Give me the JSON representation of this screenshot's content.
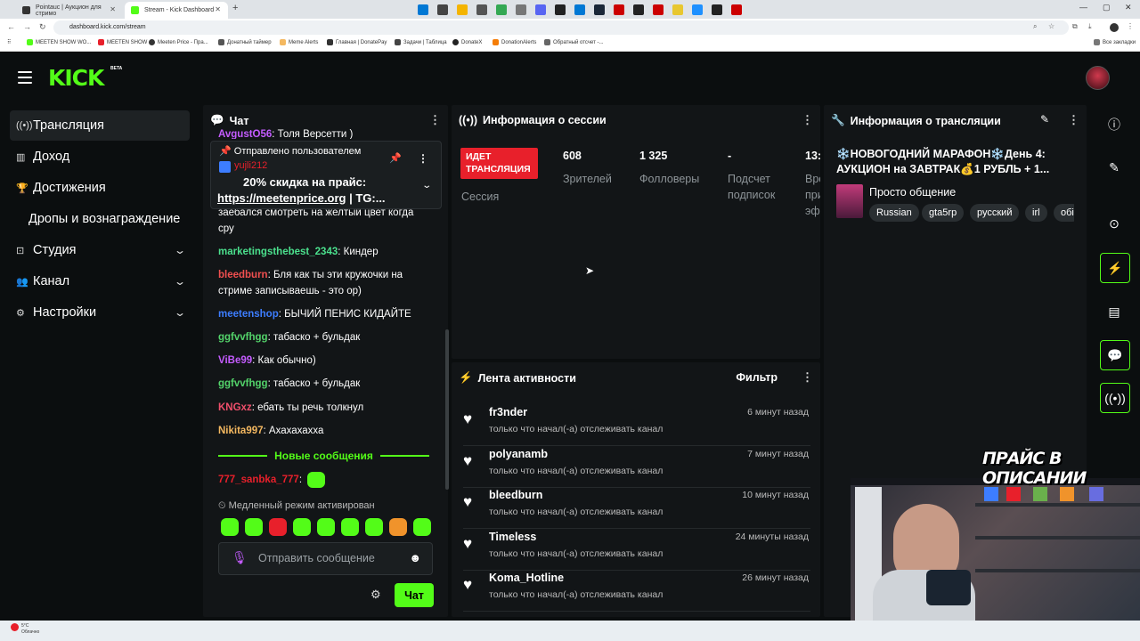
{
  "browser": {
    "tabs": [
      {
        "title": "Pointauc | Аукцион для стримо"
      },
      {
        "title": "Stream - Kick Dashboard"
      }
    ],
    "url": "dashboard.kick.com/stream",
    "bookmarks": [
      "MEETEN SHOW WO...",
      "MEETEN SHOW",
      "Meeten Price - Пра...",
      "Донатный таймер",
      "Meme Alerts",
      "Главная | DonatePay",
      "Задачи | Таблица",
      "DonateX",
      "DonationAlerts",
      "Обратный отсчет -...",
      "Все закладки"
    ]
  },
  "header": {
    "logo": "KICK",
    "beta": "BETA"
  },
  "sidebar": {
    "items": [
      {
        "label": "Трансляция"
      },
      {
        "label": "Доход"
      },
      {
        "label": "Достижения"
      },
      {
        "label": "Дропы и вознаграждение"
      },
      {
        "label": "Студия"
      },
      {
        "label": "Канал"
      },
      {
        "label": "Настройки"
      }
    ]
  },
  "chat": {
    "title": "Чат",
    "top_partial": {
      "user": "AvgustO56",
      "text": ": Толя Версетти )"
    },
    "pinned": {
      "header": "Отправлено пользователем",
      "user": "yujli212",
      "line1": "20% скидка на прайс:",
      "link": "https://meetenprice.org",
      "line2_suffix": " | TG:..."
    },
    "partial_text": "заебался смотреть на желтый цвет когда сру",
    "messages": [
      {
        "user": "marketingsthebest_2343",
        "text": ": Киндер",
        "color": "#4be08d"
      },
      {
        "user": "bleedburn",
        "text": ": Бля как ты эти кружочки на стриме записываешь - это ор)",
        "color": "#ef4f4f"
      },
      {
        "user": "meetenshop",
        "text": ": БЫЧИЙ ПЕНИС КИДАЙТЕ",
        "color": "#3d7dff"
      },
      {
        "user": "ggfvvfhgg",
        "text": ": табаско + бульдак",
        "color": "#53d36a"
      },
      {
        "user": "ViBe99",
        "text": ": Как обычно)",
        "color": "#c45cff"
      },
      {
        "user": "ggfvvfhgg",
        "text": ": табаско + бульдак",
        "color": "#53d36a"
      },
      {
        "user": "KNGxz",
        "text": ": ебать ты речь толкнул",
        "color": "#ef4f6b"
      },
      {
        "user": "Nikita997",
        "text": ": Ахахахахха",
        "color": "#f4b860"
      }
    ],
    "new_messages": "Новые сообщения",
    "after_new": {
      "user": "777_sanbka_777",
      "text": ":",
      "color": "#e8202b"
    },
    "slow_mode": "Медленный режим активирован",
    "input_placeholder": "Отправить сообщение",
    "send_button": "Чат"
  },
  "session": {
    "title": "Информация о сессии",
    "live_badge": "ИДЕТ ТРАНСЛЯЦИЯ",
    "session_label": "Сессия",
    "stats": [
      {
        "value": "608",
        "label": "Зрителей"
      },
      {
        "value": "1 325",
        "label": "Фолловеры"
      },
      {
        "value": "-",
        "label": "Подсчет подписок"
      },
      {
        "value": "13:",
        "label": "Вре\nпри\nэфи"
      }
    ]
  },
  "activity": {
    "title": "Лента активности",
    "filter": "Фильтр",
    "items": [
      {
        "name": "fr3nder",
        "desc": "только что начал(-а) отслеживать канал",
        "time": "6 минут назад"
      },
      {
        "name": "polyanamb",
        "desc": "только что начал(-а) отслеживать канал",
        "time": "7 минут назад"
      },
      {
        "name": "bleedburn",
        "desc": "только что начал(-а) отслеживать канал",
        "time": "10 минут назад"
      },
      {
        "name": "Timeless",
        "desc": "только что начал(-а) отслеживать канал",
        "time": "24 минуты назад"
      },
      {
        "name": "Koma_Hotline",
        "desc": "только что начал(-а) отслеживать канал",
        "time": "26 минут назад"
      }
    ]
  },
  "stream_info": {
    "title": "Информация о трансляции",
    "stream_title": "❄️НОВОГОДНИЙ МАРАФОН❄️День 4: АУКЦИОН на ЗАВТРАК💰1 РУБЛЬ + 1...",
    "category": "Просто общение",
    "tags": [
      "Russian",
      "gta5rp",
      "русский",
      "irl",
      "обі"
    ]
  },
  "overlay": {
    "price_text": "ПРАЙС В ОПИСАНИИ"
  },
  "taskbar": {
    "weather_temp": "5°C",
    "weather_desc": "Облачно"
  },
  "colors": {
    "accent": "#53fc18",
    "live": "#e8202b",
    "panel": "#121517",
    "bg": "#0b0e0f"
  }
}
